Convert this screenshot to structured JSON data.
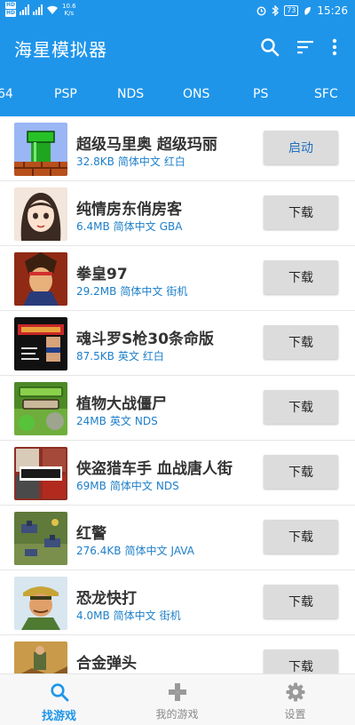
{
  "status_bar": {
    "net_speed_value": "10.6",
    "net_speed_unit": "K/s",
    "battery": "73",
    "time": "15:26"
  },
  "app_bar": {
    "title": "海星模拟器",
    "icons": [
      "search-icon",
      "sort-icon",
      "more-vert-icon"
    ]
  },
  "tabs": [
    "64",
    "PSP",
    "NDS",
    "ONS",
    "PS",
    "SFC"
  ],
  "games": [
    {
      "title": "超级马里奥 超级玛丽",
      "size": "32.8KB",
      "language": "简体中文",
      "platform": "红白",
      "action": "启动"
    },
    {
      "title": "纯情房东俏房客",
      "size": "6.4MB",
      "language": "简体中文",
      "platform": "GBA",
      "action": "下载"
    },
    {
      "title": "拳皇97",
      "size": "29.2MB",
      "language": "简体中文",
      "platform": "街机",
      "action": "下载"
    },
    {
      "title": "魂斗罗S枪30条命版",
      "size": "87.5KB",
      "language": "英文",
      "platform": "红白",
      "action": "下载"
    },
    {
      "title": "植物大战僵尸",
      "size": "24MB",
      "language": "英文",
      "platform": "NDS",
      "action": "下载"
    },
    {
      "title": "侠盗猎车手 血战唐人街",
      "size": "69MB",
      "language": "简体中文",
      "platform": "NDS",
      "action": "下载"
    },
    {
      "title": "红警",
      "size": "276.4KB",
      "language": "简体中文",
      "platform": "JAVA",
      "action": "下载"
    },
    {
      "title": "恐龙快打",
      "size": "4.0MB",
      "language": "简体中文",
      "platform": "街机",
      "action": "下载"
    },
    {
      "title": "合金弹头",
      "size": "",
      "language": "",
      "platform": "",
      "action": "下载"
    }
  ],
  "bottom_nav": [
    {
      "label": "找游戏",
      "icon": "search-icon",
      "active": true
    },
    {
      "label": "我的游戏",
      "icon": "gamepad-icon",
      "active": false
    },
    {
      "label": "设置",
      "icon": "gear-icon",
      "active": false
    }
  ],
  "colors": {
    "primary": "#1f95ea",
    "meta_text": "#1d7fc9",
    "button_bg": "#dcdcdc"
  }
}
